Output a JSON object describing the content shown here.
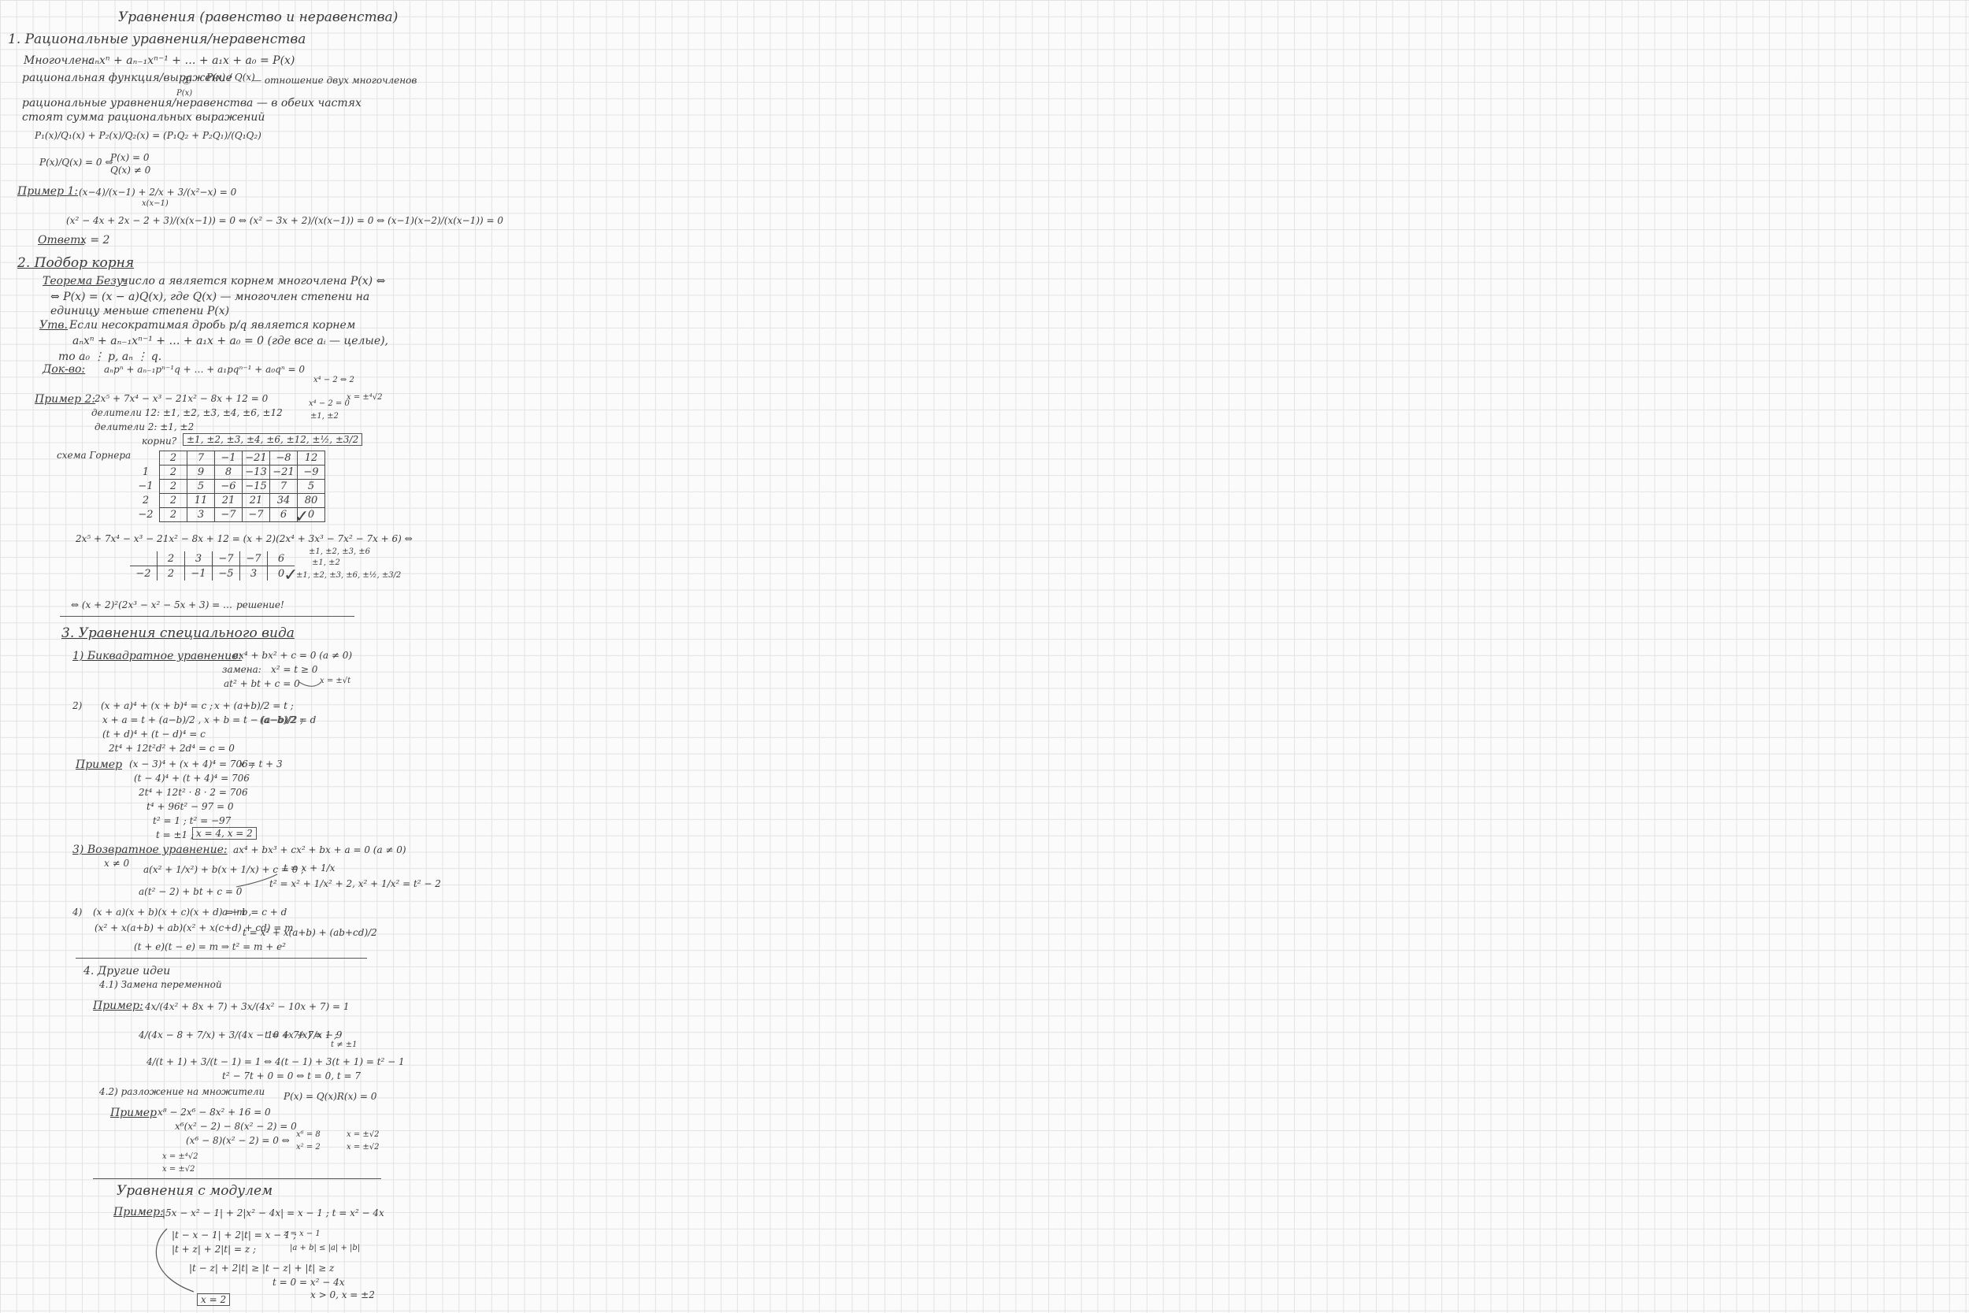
{
  "title": "Уравнения (равенство и неравенства)",
  "sec1": {
    "heading": "1. Рациональные уравнения/неравенства",
    "poly_label": "Многочлен:",
    "poly_formula": "aₙxⁿ + aₙ₋₁xⁿ⁻¹ + … + a₁x + a₀ = P(x)",
    "ratfunc_label": "рациональная функция/выражение",
    "ratfunc_formula": "P(x) / Q(x)",
    "ratfunc_note": "— отношение двух многочленов",
    "circle_one": "①",
    "px_small": "P(x)",
    "def1": "рациональные уравнения/неравенства — в обеих частях",
    "def2": "стоят сумма рациональных выражений",
    "sum_formula": "P₁(x)/Q₁(x) + P₂(x)/Q₂(x) = (P₁Q₂ + P₂Q₁)/(Q₁Q₂)",
    "eq_zero_lhs": "P(x)/Q(x) = 0  ⇔",
    "sys_top": "P(x) = 0",
    "sys_bottom": "Q(x) ≠ 0",
    "ex1_label": "Пример 1:",
    "ex1_formula": "(x−4)/(x−1) + 2/x + 3/(x²−x) = 0",
    "ex1_note": "x(x−1)",
    "ex1_steps": "(x² − 4x + 2x − 2 + 3)/(x(x−1)) = 0 ⇔ (x² − 3x + 2)/(x(x−1)) = 0 ⇔ (x−1)(x−2)/(x(x−1)) = 0",
    "answer_label": "Ответ:",
    "answer_value": "x = 2"
  },
  "sec2": {
    "heading": "2. Подбор корня",
    "bezout_label": "Теорема Безу:",
    "bezout1": "число a является корнем многочлена P(x) ⇔",
    "bezout2": "⇔ P(x) = (x − a)Q(x), где Q(x) — многочлен степени на",
    "bezout3": "единицу меньше степени P(x)",
    "claim_label": "Утв.",
    "claim1": "Если несократимая дробь p/q является корнем",
    "claim2": "aₙxⁿ + aₙ₋₁xⁿ⁻¹ + … + a₁x + a₀ = 0   (где все aᵢ — целые),",
    "claim3": "то a₀ ⋮ p, aₙ ⋮ q.",
    "proof_label": "Док-во:",
    "proof_formula": "aₙpⁿ + aₙ₋₁pⁿ⁻¹q + … + a₁pqⁿ⁻¹ + a₀qⁿ = 0",
    "side_note1": "x⁴ − 2 ⇔ 2",
    "side_note2": "x⁴ − 2 = 0",
    "side_note3": "x = ±⁴√2",
    "side_note4": "±1, ±2",
    "ex2_label": "Пример 2:",
    "ex2_eq": "2x⁵ + 7x⁴ − x³ − 21x² − 8x + 12 = 0",
    "divisors12": "делители 12: ±1, ±2, ±3, ±4, ±6, ±12",
    "divisors2": "делители 2: ±1, ±2",
    "roots_label": "корни?",
    "roots_list": "±1, ±2, ±3, ±4, ±6, ±12, ±½, ±3/2",
    "horner_label": "схема Горнера",
    "horner_rows": [
      [
        "",
        "2",
        "7",
        "−1",
        "−21",
        "−8",
        "12"
      ],
      [
        "1",
        "2",
        "9",
        "8",
        "−13",
        "−21",
        "−9"
      ],
      [
        "−1",
        "2",
        "5",
        "−6",
        "−15",
        "7",
        "5"
      ],
      [
        "2",
        "2",
        "11",
        "21",
        "21",
        "34",
        "80"
      ],
      [
        "−2",
        "2",
        "3",
        "−7",
        "−7",
        "6",
        "0"
      ]
    ],
    "check": "✓",
    "factor_eq": "2x⁵ + 7x⁴ − x³ − 21x² − 8x + 12 = (x + 2)(2x⁴ + 3x³ − 7x² − 7x + 6) ⇔",
    "horner2_rows": [
      [
        "",
        "2",
        "3",
        "−7",
        "−7",
        "6"
      ],
      [
        "−2",
        "2",
        "−1",
        "−5",
        "3",
        "0"
      ]
    ],
    "check2": "✓",
    "side2_a": "±1, ±2, ±3, ±6",
    "side2_b": "±1, ±2",
    "side2_c": "±1, ±2, ±3, ±6, ±½, ±3/2",
    "final_eq": "⇔ (x + 2)²(2x³ − x² − 5x + 3) = …",
    "final_note": "решение!"
  },
  "sec3": {
    "heading": "3. Уравнения специального вида",
    "b1_label": "1) Биквадратное уравнение:",
    "b1_eq": "ax⁴ + bx² + c = 0   (a ≠ 0)",
    "b1_sub_label": "замена:",
    "b1_sub": "x² = t ≥ 0",
    "b1_res": "at² + bt + c = 0",
    "b1_x": "x = ±√t",
    "b2_label": "2)",
    "b2_eq": "(x + a)⁴ + (x + b)⁴ = c ;",
    "b2_sub": "x + (a+b)/2 = t ;",
    "b2_l2": "x + a = t + (a−b)/2 ,  x + b = t − (a−b)/2 ;",
    "b2_d": "(a−b)/2 = d",
    "b2_l3": "(t + d)⁴ + (t − d)⁴ = c",
    "b2_l4": "2t⁴ + 12t²d² + 2d⁴ = c = 0",
    "ex3_label": "Пример",
    "ex3_l1": "(x − 3)⁴ + (x + 4)⁴ = 706 ;",
    "ex3_sub": "x = t + 3",
    "ex3_l2": "(t − 4)⁴ + (t + 4)⁴ = 706",
    "ex3_l3": "2t⁴ + 12t² · 8 · 2 = 706",
    "ex3_l4": "t⁴ + 96t² − 97 = 0",
    "ex3_l5": "t² = 1 ;   t² = −97",
    "ex3_l6": "t = ±1 ;",
    "ex3_answer": "x = 4,  x = 2",
    "b3_label": "3) Возвратное уравнение:",
    "b3_eq": "ax⁴ + bx³ + cx² + bx + a = 0   (a ≠ 0)",
    "b3_note": "x ≠ 0",
    "b3_l1": "a(x² + 1/x²) + b(x + 1/x) + c = 0 ;",
    "b3_t": "t = x + 1/x",
    "b3_t2": "t² = x² + 1/x² + 2,  x² + 1/x² = t² − 2",
    "b3_l2": "a(t² − 2) + bt + c = 0",
    "b4_label": "4)",
    "b4_eq": "(x + a)(x + b)(x + c)(x + d) = m ,",
    "b4_cond": "a + b = c + d",
    "b4_l1": "(x² + x(a+b) + ab)(x² + x(c+d) + cd) = m",
    "b4_t": "t = x² + x(a+b) + (ab+cd)/2",
    "b4_l2": "(t + e)(t − e) = m  ⇒  t² = m + e²"
  },
  "sec4": {
    "heading": "4. Другие идеи",
    "sub1": "4.1) Замена переменной",
    "ex_label": "Пример:",
    "ex_eq": "4x/(4x² + 8x + 7) + 3x/(4x² − 10x + 7) = 1",
    "l2": "4/(4x − 8 + 7/x) + 3/(4x − 10 + 7/x) = 1 ;",
    "t_def": "t = 4x + 7/x − 9",
    "t_note": "t ≠ ±1",
    "l3": "4/(t + 1) + 3/(t − 1) = 1  ⇔  4(t − 1) + 3(t + 1) = t² − 1",
    "l4": "t² − 7t + 0 = 0  ⇔  t = 0,  t = 7",
    "sub2": "4.2) разложение на множители",
    "factor_note": "P(x) = Q(x)R(x) = 0",
    "ex2_label": "Пример",
    "ex2_l1": "x⁸ − 2x⁶ − 8x² + 16 = 0",
    "ex2_l2": "x⁶(x² − 2) − 8(x² − 2) = 0",
    "ex2_l3": "(x⁶ − 8)(x² − 2) = 0  ⇔",
    "ex2_case1a": "x⁶ = 8",
    "ex2_case1b": "x² = 2",
    "ex2_case2a": "x = ±√2",
    "ex2_case2b": "x = ±√2",
    "ex2_final_a": "x = ±⁴√2",
    "ex2_final_b": "x = ±√2"
  },
  "sec5": {
    "heading": "Уравнения с модулем",
    "ex_label": "Пример:",
    "ex_eq": "|5x − x² − 1| + 2|x² − 4x| = x − 1 ;   t = x² − 4x",
    "l2": "|t − x − 1| + 2|t| = x − 1 ;",
    "l2_sub": "z = x − 1",
    "l3": "|t + z| + 2|t| = z ;",
    "l3_note": "|a + b| ≤ |a| + |b|",
    "l4": "|t − z| + 2|t| ≥ |t − z| + |t| ≥ z",
    "l5": "t = 0 = x² − 4x",
    "l6": "x > 0,  x = ±2",
    "answer": "x = 2"
  }
}
